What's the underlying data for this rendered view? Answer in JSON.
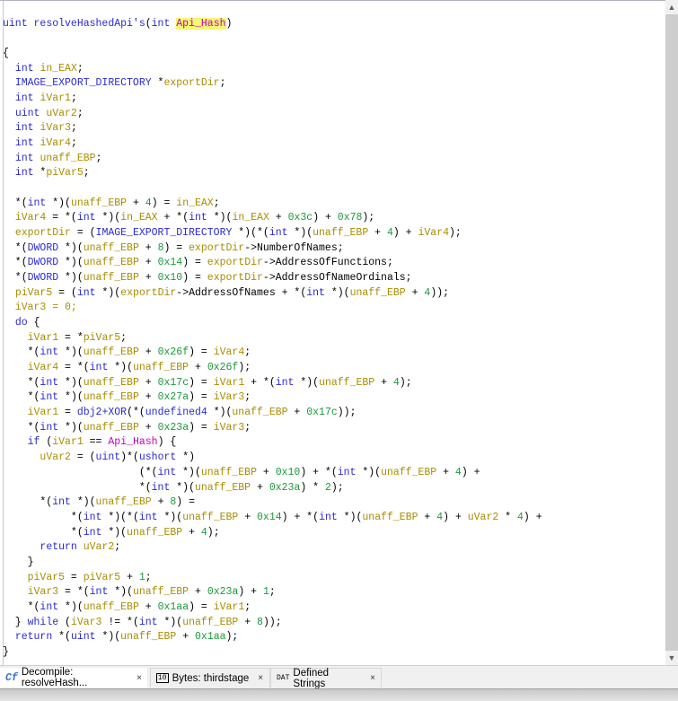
{
  "code": {
    "lines": [
      "",
      "uint resolveHashedApi's(int Api_Hash)",
      "",
      "{",
      "  int in_EAX;",
      "  IMAGE_EXPORT_DIRECTORY *exportDir;",
      "  int iVar1;",
      "  uint uVar2;",
      "  int iVar3;",
      "  int iVar4;",
      "  int unaff_EBP;",
      "  int *piVar5;",
      "",
      "  *(int *)(unaff_EBP + 4) = in_EAX;",
      "  iVar4 = *(int *)(in_EAX + *(int *)(in_EAX + 0x3c) + 0x78);",
      "  exportDir = (IMAGE_EXPORT_DIRECTORY *)(*(int *)(unaff_EBP + 4) + iVar4);",
      "  *(DWORD *)(unaff_EBP + 8) = exportDir->NumberOfNames;",
      "  *(DWORD *)(unaff_EBP + 0x14) = exportDir->AddressOfFunctions;",
      "  *(DWORD *)(unaff_EBP + 0x10) = exportDir->AddressOfNameOrdinals;",
      "  piVar5 = (int *)(exportDir->AddressOfNames + *(int *)(unaff_EBP + 4));",
      "  iVar3 = 0;",
      "  do {",
      "    iVar1 = *piVar5;",
      "    *(int *)(unaff_EBP + 0x26f) = iVar4;",
      "    iVar4 = *(int *)(unaff_EBP + 0x26f);",
      "    *(int *)(unaff_EBP + 0x17c) = iVar1 + *(int *)(unaff_EBP + 4);",
      "    *(int *)(unaff_EBP + 0x27a) = iVar3;",
      "    iVar1 = dbj2+XOR(*(undefined4 *)(unaff_EBP + 0x17c));",
      "    *(int *)(unaff_EBP + 0x23a) = iVar3;",
      "    if (iVar1 == Api_Hash) {",
      "      uVar2 = (uint)*(ushort *)",
      "                      (*(int *)(unaff_EBP + 0x10) + *(int *)(unaff_EBP + 4) +",
      "                      *(int *)(unaff_EBP + 0x23a) * 2);",
      "      *(int *)(unaff_EBP + 8) =",
      "           *(int *)(*(int *)(unaff_EBP + 0x14) + *(int *)(unaff_EBP + 4) + uVar2 * 4) +",
      "           *(int *)(unaff_EBP + 4);",
      "      return uVar2;",
      "    }",
      "    piVar5 = piVar5 + 1;",
      "    iVar3 = *(int *)(unaff_EBP + 0x23a) + 1;",
      "    *(int *)(unaff_EBP + 0x1aa) = iVar1;",
      "  } while (iVar3 != *(int *)(unaff_EBP + 8));",
      "  return *(uint *)(unaff_EBP + 0x1aa);",
      "}"
    ]
  },
  "tabs": [
    {
      "label": "Decompile: resolveHash...",
      "icon": "decompile-icon",
      "icon_text": "Cf",
      "close": "×"
    },
    {
      "label": "Bytes: thirdstage",
      "icon": "bytes-icon",
      "icon_text": "10",
      "close": "×"
    },
    {
      "label": "Defined Strings",
      "icon": "defined-strings-icon",
      "icon_text": "DAT",
      "close": "×"
    }
  ],
  "scroll": {
    "up": "▲",
    "down": "▼"
  },
  "colors": {
    "keyword": "#2a2ad0",
    "variable": "#a88d00",
    "number": "#1a9a3a",
    "param": "#c000c0",
    "highlight": "#f7f770"
  }
}
